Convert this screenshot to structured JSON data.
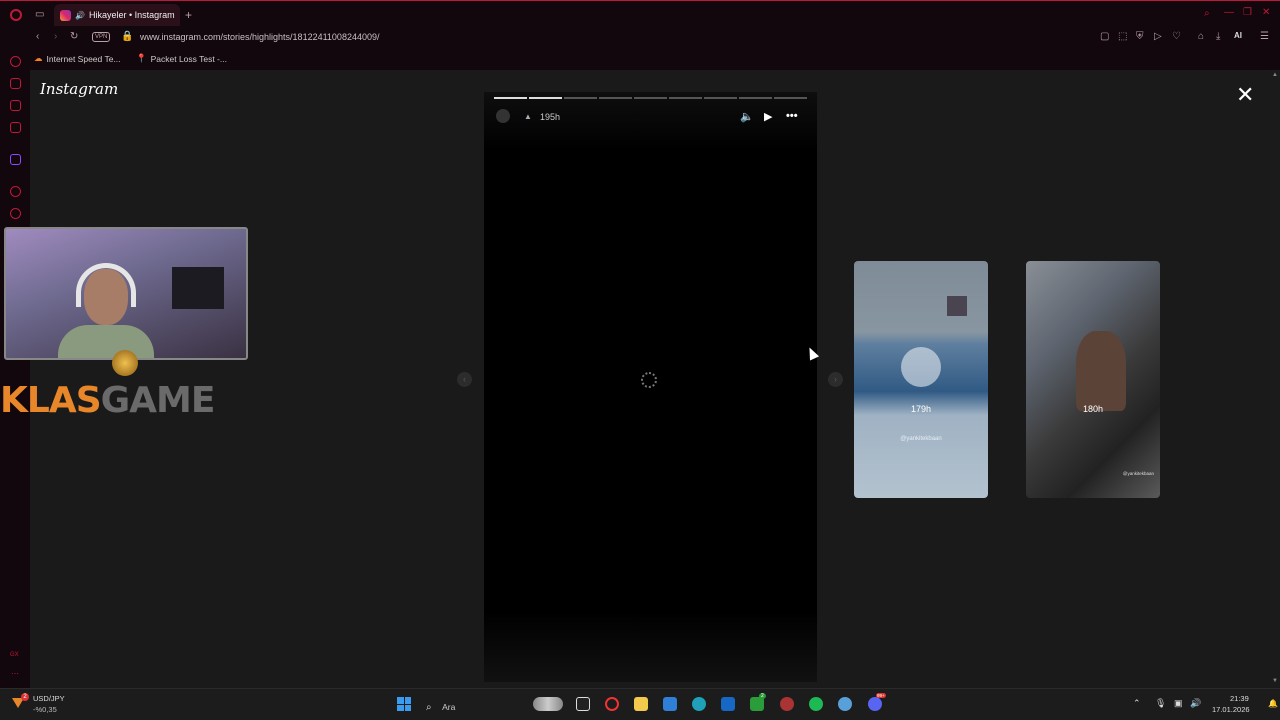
{
  "browser": {
    "tab_title": "Hikayeler • Instagram",
    "url": "www.instagram.com/stories/highlights/18122411008244009/",
    "vpn_label": "VPN",
    "bookmarks": [
      {
        "label": "Internet Speed Te..."
      },
      {
        "label": "Packet Loss Test -..."
      }
    ],
    "ai_label": "AI"
  },
  "instagram": {
    "logo": "Instagram",
    "story": {
      "time": "195h",
      "progress_total": 9,
      "progress_done": 2
    },
    "thumbnails": [
      {
        "time": "179h",
        "caption": "@yankitekbaan"
      },
      {
        "time": "180h",
        "caption": "@yankitekbaan"
      }
    ]
  },
  "overlay": {
    "brand_part1": "KLAS",
    "brand_part2": "GAME"
  },
  "taskbar": {
    "ticker_symbol": "USD/JPY",
    "ticker_change": "-%0,35",
    "ticker_badge": "2",
    "search_placeholder": "Ara",
    "time": "21:39",
    "date": "17.01.2026",
    "chat_badge": "99+",
    "store_badge": "2"
  },
  "colors": {
    "accent": "#c0183a",
    "brand_orange": "#e8862a",
    "brand_gray": "#6a6a6a"
  }
}
